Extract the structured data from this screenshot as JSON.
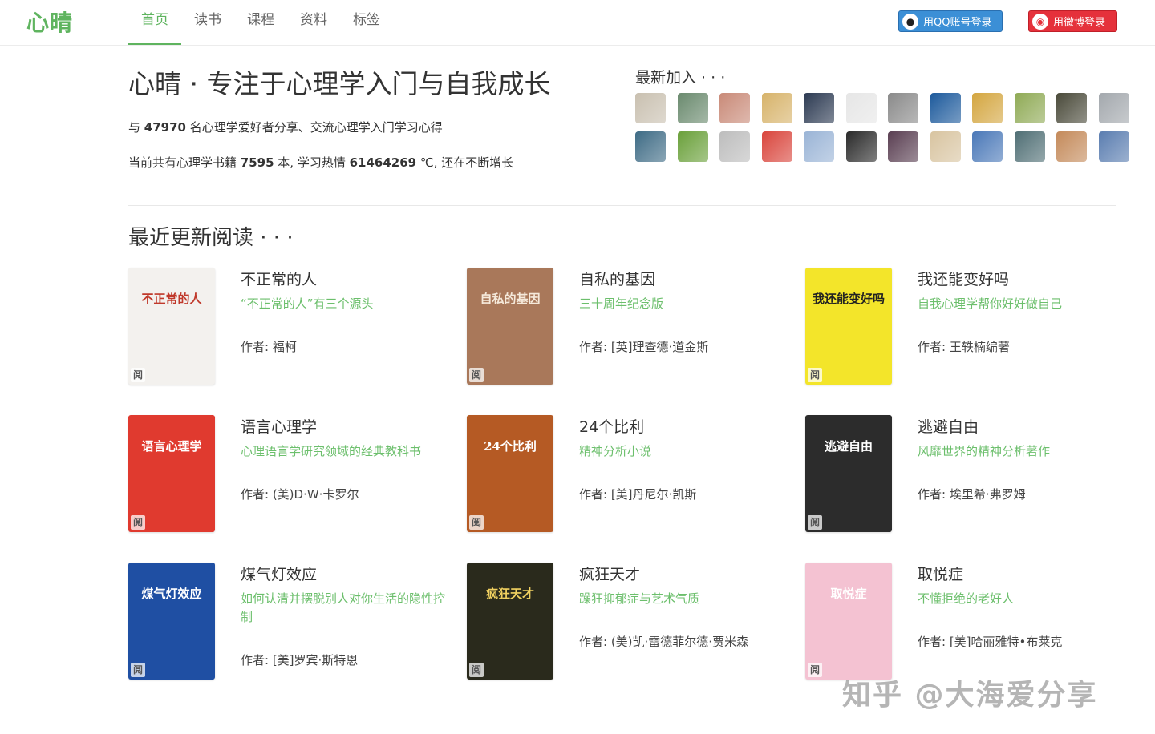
{
  "header": {
    "logo": "心晴",
    "nav": [
      "首页",
      "读书",
      "课程",
      "资料",
      "标签"
    ],
    "qq_login": "用QQ账号登录",
    "weibo_login": "用微博登录",
    "qq_icon": "penguin-icon",
    "weibo_icon": "weibo-eye-icon"
  },
  "hero": {
    "title": "心晴 · 专注于心理学入门与自我成长",
    "members_prefix": "与 ",
    "members_count": "47970",
    "members_suffix": " 名心理学爱好者分享、交流心理学入门学习心得",
    "books_prefix": "当前共有心理学书籍 ",
    "books_count": "7595",
    "books_mid": " 本, 学习热情 ",
    "heat": "61464269",
    "books_suffix": " ℃, 还在不断增长"
  },
  "recent_members": {
    "title": "最新加入 · · ·",
    "avatar_colors": [
      "#c9c0b0",
      "#6a8a6e",
      "#c98a78",
      "#d7b36a",
      "#2c3a52",
      "#e6e6e6",
      "#8a8a8a",
      "#1d5a9c",
      "#d4a640",
      "#8faa55",
      "#4a4a3a",
      "#a3a8ad",
      "#3e6b85",
      "#6aa03a",
      "#bdbdbd",
      "#d9453c",
      "#9ab4d6",
      "#2a2a2a",
      "#5a3f52",
      "#d8c4a0",
      "#4a78b8",
      "#4f6e74",
      "#c48a5a",
      "#5a7db0"
    ]
  },
  "section": {
    "title": "最近更新阅读 · · ·"
  },
  "read_tag": "阅",
  "books": [
    {
      "name": "不正常的人",
      "sub": "“不正常的人”有三个源头",
      "author": "作者: 福柯",
      "cover_bg": "#f3f1ee",
      "cover_fg": "#c0392b",
      "cover_text": "不正常的人"
    },
    {
      "name": "自私的基因",
      "sub": "三十周年纪念版",
      "author": "作者: [英]理查德·道金斯",
      "cover_bg": "#a9785a",
      "cover_fg": "#f5e9da",
      "cover_text": "自私的基因"
    },
    {
      "name": "我还能变好吗",
      "sub": "自我心理学帮你好好做自己",
      "author": "作者: 王轶楠编著",
      "cover_bg": "#f3e52a",
      "cover_fg": "#222222",
      "cover_text": "我还能变好吗"
    },
    {
      "name": "语言心理学",
      "sub": "心理语言学研究领域的经典教科书",
      "author": "作者: (美)D·W·卡罗尔",
      "cover_bg": "#e03a2f",
      "cover_fg": "#ffffff",
      "cover_text": "语言心理学"
    },
    {
      "name": "24个比利",
      "sub": "精神分析小说",
      "author": "作者: [美]丹尼尔·凯斯",
      "cover_bg": "#b55a24",
      "cover_fg": "#ffffff",
      "cover_text": "24个比利"
    },
    {
      "name": "逃避自由",
      "sub": "风靡世界的精神分析著作",
      "author": "作者: 埃里希·弗罗姆",
      "cover_bg": "#2c2c2c",
      "cover_fg": "#ffffff",
      "cover_text": "逃避自由"
    },
    {
      "name": "煤气灯效应",
      "sub": "如何认清并摆脱别人对你生活的隐性控制",
      "author": "作者: [美]罗宾·斯特恩",
      "cover_bg": "#1f4fa3",
      "cover_fg": "#ffffff",
      "cover_text": "煤气灯效应"
    },
    {
      "name": "疯狂天才",
      "sub": "躁狂抑郁症与艺术气质",
      "author": "作者: (美)凯·雷德菲尔德·贾米森",
      "cover_bg": "#2a2a1c",
      "cover_fg": "#f0d060",
      "cover_text": "疯狂天才"
    },
    {
      "name": "取悦症",
      "sub": "不懂拒绝的老好人",
      "author": "作者: [美]哈丽雅特•布莱克",
      "cover_bg": "#f4c2d2",
      "cover_fg": "#ffffff",
      "cover_text": "取悦症"
    }
  ],
  "watermark": "知乎 @大海爱分享"
}
